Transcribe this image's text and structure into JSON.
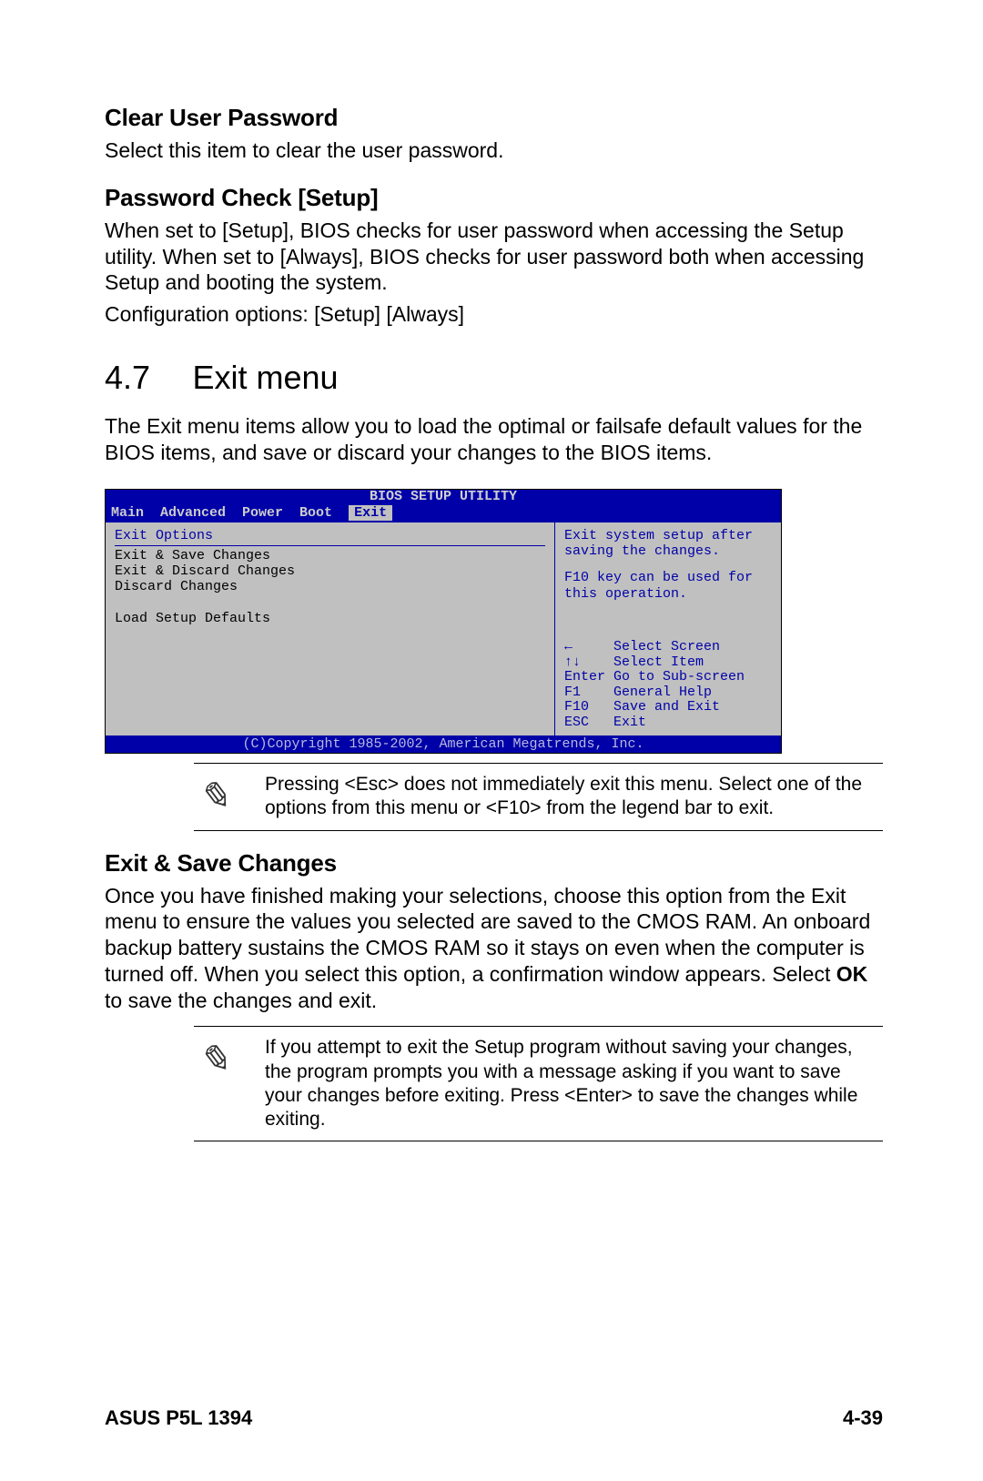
{
  "section1": {
    "heading": "Clear User Password",
    "para": "Select this item to clear the user password."
  },
  "section2": {
    "heading": "Password Check [Setup]",
    "para1": "When set to [Setup], BIOS checks for user password when accessing the Setup utility. When set to [Always], BIOS checks for user password both when accessing Setup and booting the system.",
    "para2": "Configuration options: [Setup] [Always]"
  },
  "bigheading": {
    "num": "4.7",
    "title": "Exit menu"
  },
  "intro": "The Exit menu items allow you to load the optimal or failsafe default values for the BIOS items, and save or discard your changes to the BIOS items.",
  "bios": {
    "title": "BIOS SETUP UTILITY",
    "tabs": [
      "Main",
      "Advanced",
      "Power",
      "Boot",
      "Exit"
    ],
    "left_header": "Exit Options",
    "items": [
      "Exit & Save Changes",
      "Exit & Discard Changes",
      "Discard Changes",
      "",
      "Load Setup Defaults"
    ],
    "help_top1": "Exit system setup after saving the changes.",
    "help_top2": "F10 key can be used for this operation.",
    "legend": [
      {
        "key": "←",
        "label": "Select Screen"
      },
      {
        "key": "↑↓",
        "label": "Select Item"
      },
      {
        "key": "Enter",
        "label": "Go to Sub-screen"
      },
      {
        "key": "F1",
        "label": "General Help"
      },
      {
        "key": "F10",
        "label": "Save and Exit"
      },
      {
        "key": "ESC",
        "label": "Exit"
      }
    ],
    "footer": "(C)Copyright 1985-2002, American Megatrends, Inc."
  },
  "note1": "Pressing <Esc> does not immediately exit this menu. Select one of the options from this menu or <F10> from the legend bar to exit.",
  "section3": {
    "heading": "Exit & Save Changes",
    "para_a": "Once you have finished making your selections, choose this option from the Exit menu to ensure the values you selected are saved to the CMOS RAM. An onboard backup battery sustains the CMOS RAM so it stays on even when the computer is turned off. When you select this option, a confirmation window appears. Select ",
    "bold": "OK",
    "para_b": " to save the changes and exit."
  },
  "note2": "If you attempt to exit the Setup program without saving your changes, the program prompts you with a message asking if you want to save your changes before exiting. Press <Enter> to save the changes while exiting.",
  "footer": {
    "left": "ASUS P5L 1394",
    "right": "4-39"
  }
}
